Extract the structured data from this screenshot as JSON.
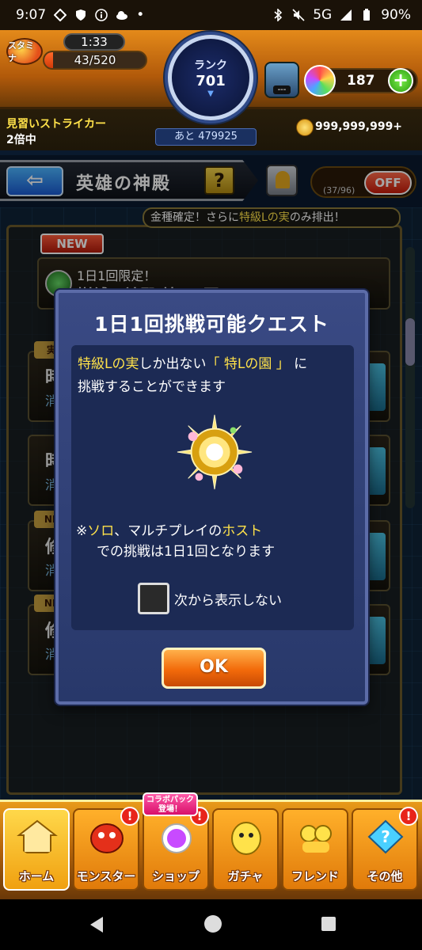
{
  "status_bar": {
    "time": "9:07",
    "network": "5G",
    "battery": "90%"
  },
  "hud": {
    "stamina_label": "スタミナ",
    "stamina_timer": "1:33",
    "stamina_count": "43/520",
    "stamina_fraction": 0.083,
    "rank_label": "ランク",
    "rank_value": "701",
    "rank_next": "あと 479925",
    "event_label": "---",
    "orb_count": "187",
    "orb_plus": "+",
    "striker_title": "見習いストライカー",
    "bonus_text": "2倍中",
    "gold_count": "999,999,999+"
  },
  "screen_header": {
    "back_label": "⇦",
    "title": "英雄の神殿",
    "help_label": "?",
    "toggle_count": "(37/96)",
    "toggle_label": "OFF"
  },
  "content": {
    "notice": "金種確定！さらに",
    "notice_highlight": "特級Lの実",
    "notice_tail": "のみ排出！",
    "new_badge": "NEW",
    "main_card_sub": "1日1回限定！",
    "main_card_name": "樹縛の神殿 特Lの園",
    "rows": [
      {
        "tag": "実",
        "t1": "時",
        "t2": "消"
      },
      {
        "tag": "",
        "t1": "時",
        "t2": "消"
      },
      {
        "tag": "NE",
        "t1": "修",
        "t2": "消"
      },
      {
        "tag": "NE",
        "t1": "修",
        "t2": "消"
      }
    ]
  },
  "modal": {
    "title": "1日1回挑戦可能クエスト",
    "line1_a": "特級Lの実",
    "line1_b": "しか出ない",
    "line1_c": "「 特Lの園 」",
    "line1_d": "に",
    "line2": "挑戦することができます",
    "note_prefix": "※",
    "note_solo": "ソロ",
    "note_mid": "、マルチプレイの",
    "note_host": "ホスト",
    "note_line2": "での挑戦は1日1回となります",
    "checkbox_label": "次から表示しない",
    "ok_label": "OK"
  },
  "bottom_nav": {
    "items": [
      {
        "label": "ホーム"
      },
      {
        "label": "モンスター",
        "badge": "!"
      },
      {
        "label": "ショップ",
        "badge": "!",
        "promo": "コラボパック\n登場！"
      },
      {
        "label": "ガチャ"
      },
      {
        "label": "フレンド"
      },
      {
        "label": "その他",
        "badge": "!"
      }
    ]
  },
  "colors": {
    "accent_orange": "#f26a0a",
    "highlight_yellow": "#ffe24a",
    "modal_blue": "#3a4a84"
  }
}
